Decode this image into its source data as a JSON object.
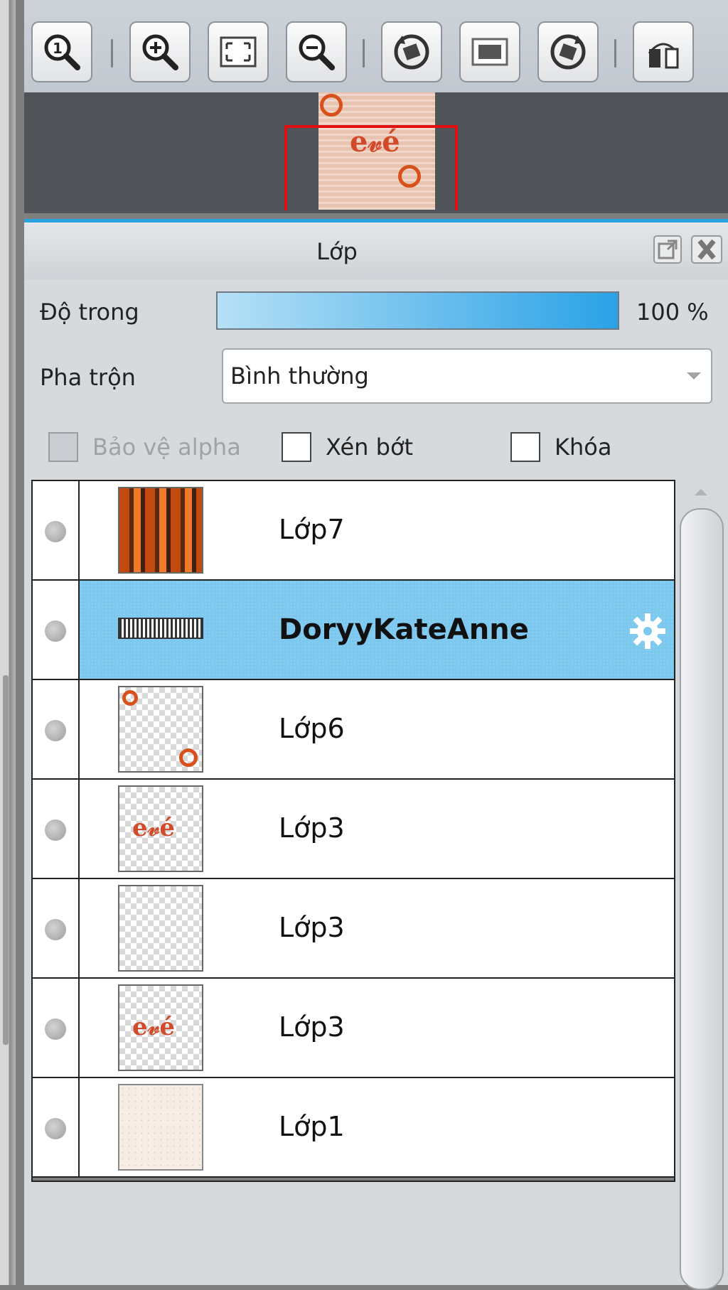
{
  "navigator": {
    "toolbar": [
      {
        "name": "zoom-actual-size-button",
        "icon": "magnifier-1-icon",
        "tooltip": ""
      },
      {
        "name": "zoom-in-button",
        "icon": "magnifier-plus-icon"
      },
      {
        "name": "fit-to-window-button",
        "icon": "fit-frame-icon"
      },
      {
        "name": "zoom-out-button",
        "icon": "magnifier-minus-icon"
      },
      {
        "name": "rotate-left-button",
        "icon": "rotate-ccw-icon"
      },
      {
        "name": "reset-view-button",
        "icon": "frame-icon"
      },
      {
        "name": "rotate-right-button",
        "icon": "rotate-cw-icon"
      },
      {
        "name": "flip-horizontal-button",
        "icon": "flip-icon"
      }
    ],
    "view_frame_color": "#e01010"
  },
  "layers_panel": {
    "title": "Lớp",
    "opacity_label": "Độ trong",
    "opacity": {
      "value": 1.0,
      "display": "100 %"
    },
    "blend_label": "Pha trộn",
    "blend_mode": "Bình thường",
    "options": {
      "protect_alpha": {
        "label": "Bảo vệ alpha",
        "checked": false,
        "disabled": true
      },
      "clipping": {
        "label": "Xén bớt",
        "checked": false
      },
      "lock": {
        "label": "Khóa",
        "checked": false
      }
    },
    "accent_color": "#2ba2e0",
    "selection_color": "#7cc8ef",
    "layers": [
      {
        "name": "Lớp7",
        "selected": false,
        "thumb": "texture"
      },
      {
        "name": "DoryyKateAnne",
        "selected": true,
        "thumb": "text"
      },
      {
        "name": "Lớp6",
        "selected": false,
        "thumb": "rings"
      },
      {
        "name": "Lớp3",
        "selected": false,
        "thumb": "heart"
      },
      {
        "name": "Lớp3",
        "selected": false,
        "thumb": "transparent"
      },
      {
        "name": "Lớp3",
        "selected": false,
        "thumb": "heart"
      },
      {
        "name": "Lớp1",
        "selected": false,
        "thumb": "paper"
      }
    ],
    "selected_layer_icon": "gear-icon"
  }
}
